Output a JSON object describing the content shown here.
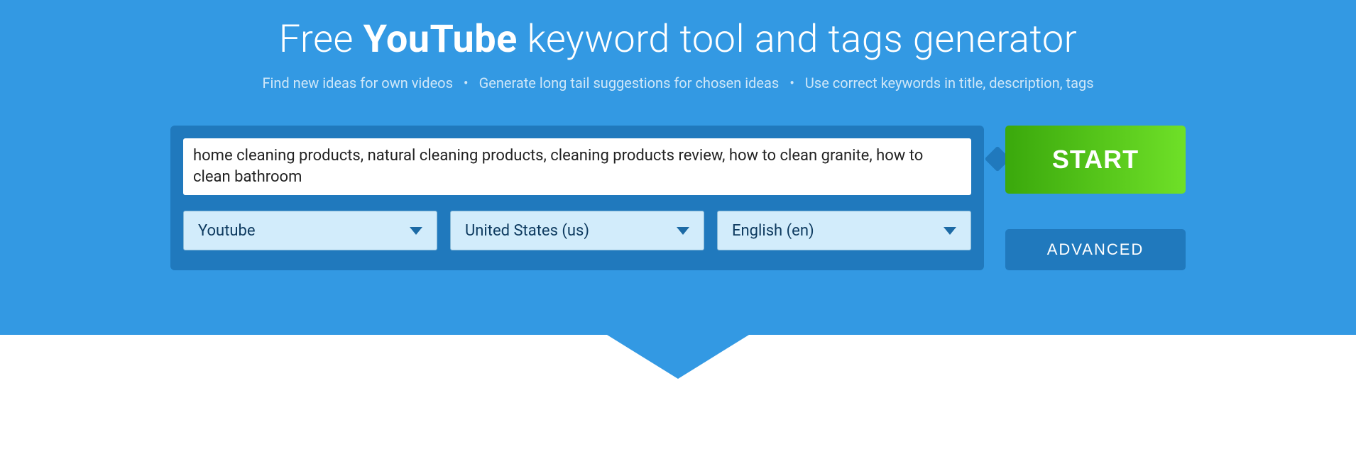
{
  "hero": {
    "title_prefix": "Free ",
    "title_strong": "YouTube",
    "title_suffix": " keyword tool and tags generator",
    "subtitle_parts": [
      "Find new ideas for own videos",
      "Generate long tail suggestions for chosen ideas",
      "Use correct keywords in title, description, tags"
    ]
  },
  "form": {
    "keywords_value": "home cleaning products, natural cleaning products, cleaning products review, how to clean granite, how to clean bathroom ",
    "platform_select": "Youtube",
    "country_select": "United States (us)",
    "language_select": "English (en)"
  },
  "buttons": {
    "start_label": "START",
    "advanced_label": "ADVANCED"
  }
}
